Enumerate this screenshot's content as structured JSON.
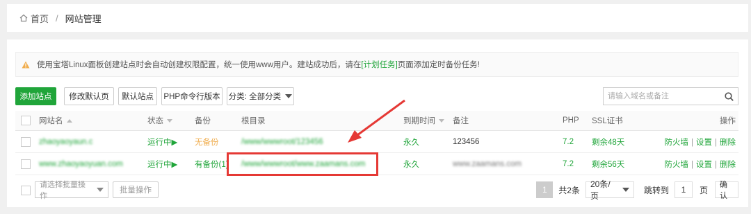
{
  "breadcrumb": {
    "home": "首页",
    "separator": "/",
    "current": "网站管理"
  },
  "notice": {
    "text_before": "使用宝塔Linux面板创建站点时会自动创建权限配置，统一使用www用户。建站成功后，请在",
    "link": "[计划任务]",
    "text_after": "页面添加定时备份任务!"
  },
  "toolbar": {
    "add_site": "添加站点",
    "edit_default_page": "修改默认页",
    "default_site": "默认站点",
    "php_cli_version": "PHP命令行版本",
    "category": "分类: 全部分类",
    "search_placeholder": "请输入域名或备注"
  },
  "table": {
    "headers": {
      "name": "网站名",
      "status": "状态",
      "backup": "备份",
      "root": "根目录",
      "expiry": "到期时间",
      "note": "备注",
      "php": "PHP",
      "ssl": "SSL证书",
      "ops": "操作"
    },
    "rows": [
      {
        "name": "zhaoyaoyaun.c",
        "status": "运行中▶",
        "backup": "无备份",
        "root": "/www/wwwroot/123456",
        "expiry": "永久",
        "note": "123456",
        "php": "7.2",
        "ssl": "剩余48天",
        "op_firewall": "防火墙",
        "op_settings": "设置",
        "op_delete": "删除"
      },
      {
        "name": "www.zhaoyaoyuan.com",
        "status": "运行中▶",
        "backup": "有备份(1)",
        "root": "/www/wwwroot/www.zaamans.com",
        "expiry": "永久",
        "note": "www.zaamans.com",
        "php": "7.2",
        "ssl": "剩余56天",
        "op_firewall": "防火墙",
        "op_settings": "设置",
        "op_delete": "删除"
      }
    ]
  },
  "footer": {
    "batch_select": "请选择批量操作",
    "batch_button": "批量操作",
    "current_page": "1",
    "total": "共2条",
    "per_page": "20条/页",
    "jump_label": "跳转到",
    "jump_value": "1",
    "page_unit": "页",
    "confirm": "确认"
  },
  "colors": {
    "accent": "#20a53a",
    "highlight": "#e53935",
    "warning": "#f0ad4e"
  }
}
